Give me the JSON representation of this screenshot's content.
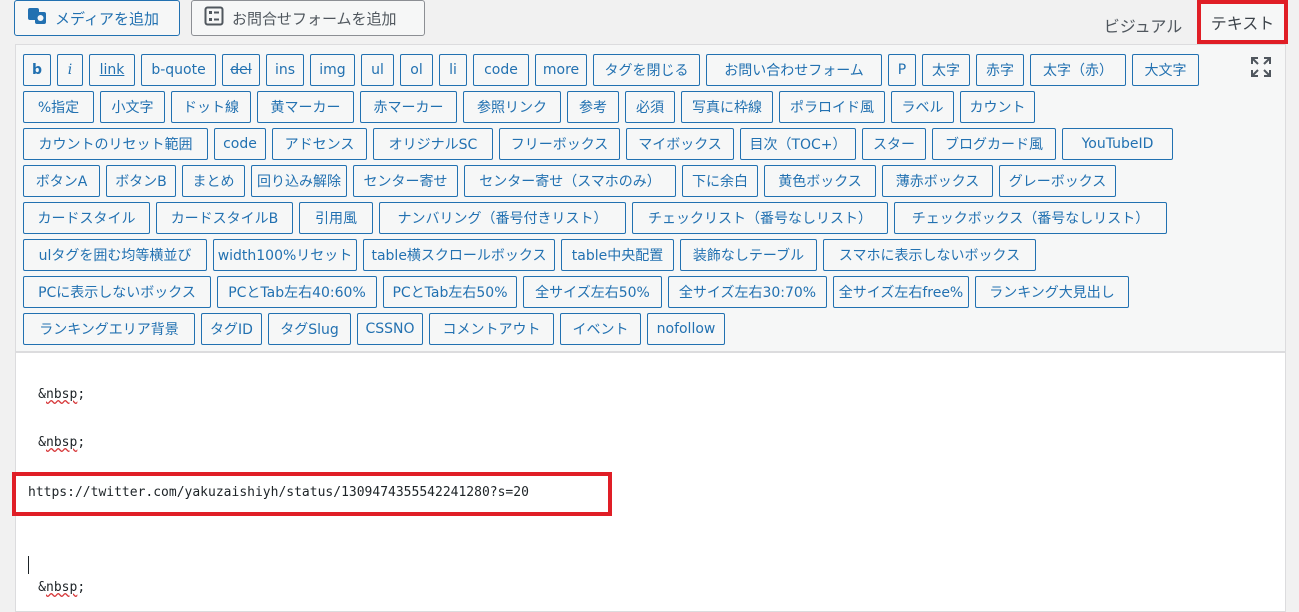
{
  "top_buttons": {
    "media_label": "メディアを追加",
    "form_label": "お問合せフォームを追加",
    "media_icon": "media-camera-icon",
    "form_icon": "form-grid-icon"
  },
  "tabs": {
    "visual": "ビジュアル",
    "text": "テキスト",
    "active": "text"
  },
  "accent_colors": {
    "button": "#2271b1",
    "highlight": "#e01e26"
  },
  "quicktags": [
    [
      "b",
      "i",
      "link",
      "b-quote",
      "del",
      "ins",
      "img",
      "ul",
      "ol",
      "li",
      "code",
      "more",
      "タグを閉じる",
      "お問い合わせフォーム",
      "P",
      "太字",
      "赤字",
      "太字（赤）",
      "大文字"
    ],
    [
      "%指定",
      "小文字",
      "ドット線",
      "黄マーカー",
      "赤マーカー",
      "参照リンク",
      "参考",
      "必須",
      "写真に枠線",
      "ポラロイド風",
      "ラベル",
      "カウント"
    ],
    [
      "カウントのリセット範囲",
      "code",
      "アドセンス",
      "オリジナルSC",
      "フリーボックス",
      "マイボックス",
      "目次（TOC+）",
      "スター",
      "ブログカード風",
      "YouTubeID"
    ],
    [
      "ボタンA",
      "ボタンB",
      "まとめ",
      "回り込み解除",
      "センター寄せ",
      "センター寄せ（スマホのみ）",
      "下に余白",
      "黄色ボックス",
      "薄赤ボックス",
      "グレーボックス"
    ],
    [
      "カードスタイル",
      "カードスタイルB",
      "引用風",
      "ナンバリング（番号付きリスト）",
      "チェックリスト（番号なしリスト）",
      "チェックボックス（番号なしリスト）"
    ],
    [
      "ulタグを囲む均等横並び",
      "width100%リセット",
      "table横スクロールボックス",
      "table中央配置",
      "装飾なしテーブル",
      "スマホに表示しないボックス"
    ],
    [
      "PCに表示しないボックス",
      "PCとTab左右40:60%",
      "PCとTab左右50%",
      "全サイズ左右50%",
      "全サイズ左右30:70%",
      "全サイズ左右free%",
      "ランキング大見出し"
    ],
    [
      "ランキングエリア背景",
      "タグID",
      "タグSlug",
      "CSSNO",
      "コメントアウト",
      "イベント",
      "nofollow"
    ]
  ],
  "fullscreen_icon": "fullscreen-expand-icon",
  "editor": {
    "line1": "&nbsp;",
    "line2": "&nbsp;",
    "url": "https://twitter.com/yakuzaishiyh/status/1309474355542241280?s=20",
    "line4": "&nbsp;"
  }
}
